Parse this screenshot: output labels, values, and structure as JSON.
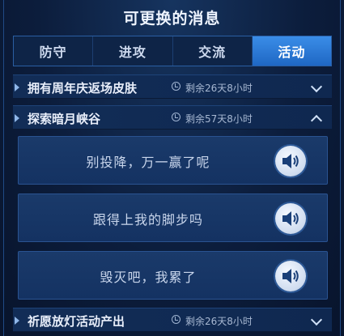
{
  "title": "可更换的消息",
  "tabs": [
    {
      "label": "防守",
      "active": false
    },
    {
      "label": "进攻",
      "active": false
    },
    {
      "label": "交流",
      "active": false
    },
    {
      "label": "活动",
      "active": true
    }
  ],
  "sections": [
    {
      "name": "拥有周年庆返场皮肤",
      "time": "剩余26天8小时",
      "expanded": false
    },
    {
      "name": "探索暗月峡谷",
      "time": "剩余57天8小时",
      "expanded": true
    },
    {
      "name": "祈愿放灯活动产出",
      "time": "剩余26天8小时",
      "expanded": false
    }
  ],
  "messages": [
    {
      "text": "别投降，万一赢了呢",
      "icon": "speaker-icon"
    },
    {
      "text": "跟得上我的脚步吗",
      "icon": "speaker-icon"
    },
    {
      "text": "毁灭吧，我累了",
      "icon": "speaker-icon"
    }
  ],
  "colors": {
    "background": "#0c1d3c",
    "active_tab": "#2a7ad8",
    "text": "#dfe8f8"
  }
}
